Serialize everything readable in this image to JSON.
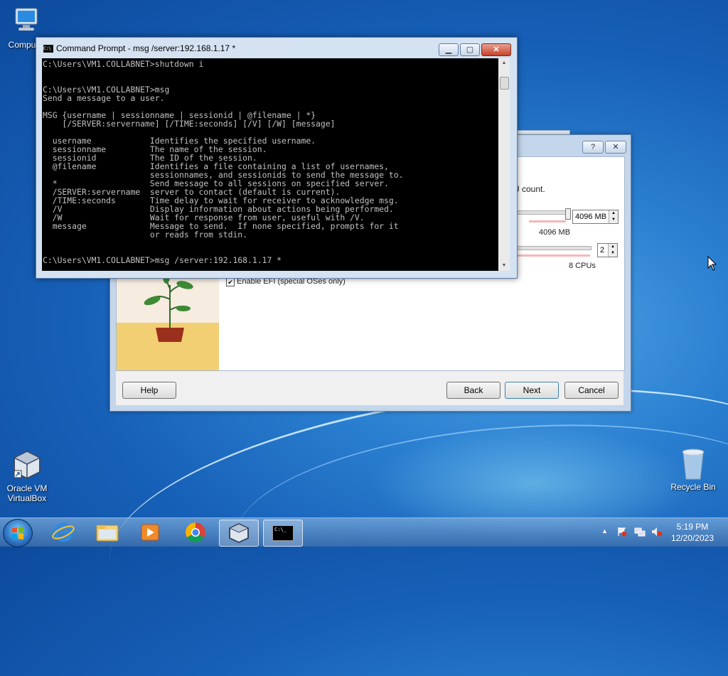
{
  "desktop": {
    "icons": {
      "computer": "Computer",
      "virtualbox_line1": "Oracle VM",
      "virtualbox_line2": "VirtualBox",
      "recycle_bin": "Recycle Bin"
    }
  },
  "wizard": {
    "cpu_hint": "U count.",
    "memory_value": "4096 MB",
    "memory_max_label": "4096 MB",
    "cpu_value": "2",
    "cpu_max_label": "8 CPUs",
    "efi_label": "Enable EFI (special OSes only)",
    "help_label": "Help",
    "back_label": "Back",
    "next_label": "Next",
    "cancel_label": "Cancel",
    "help_title_btn": "?",
    "close_title_btn": "✕"
  },
  "cmd": {
    "title": "Command Prompt - msg  /server:192.168.1.17 *",
    "icon_text": "C:\\",
    "minimize": "▁",
    "maximize": "▢",
    "close": "✕",
    "output": "C:\\Users\\VM1.COLLABNET>shutdown i\n\n\nC:\\Users\\VM1.COLLABNET>msg\nSend a message to a user.\n\nMSG {username | sessionname | sessionid | @filename | *}\n    [/SERVER:servername] [/TIME:seconds] [/V] [/W] [message]\n\n  username            Identifies the specified username.\n  sessionname         The name of the session.\n  sessionid           The ID of the session.\n  @filename           Identifies a file containing a list of usernames,\n                      sessionnames, and sessionids to send the message to.\n  *                   Send message to all sessions on specified server.\n  /SERVER:servername  server to contact (default is current).\n  /TIME:seconds       Time delay to wait for receiver to acknowledge msg.\n  /V                  Display information about actions being performed.\n  /W                  Wait for response from user, useful with /V.\n  message             Message to send.  If none specified, prompts for it\n                      or reads from stdin.\n\n\nC:\\Users\\VM1.COLLABNET>msg /server:192.168.1.17 *"
  },
  "taskbar": {
    "time": "5:19 PM",
    "date": "12/20/2023",
    "cmd_icon_text": "C:\\_"
  }
}
